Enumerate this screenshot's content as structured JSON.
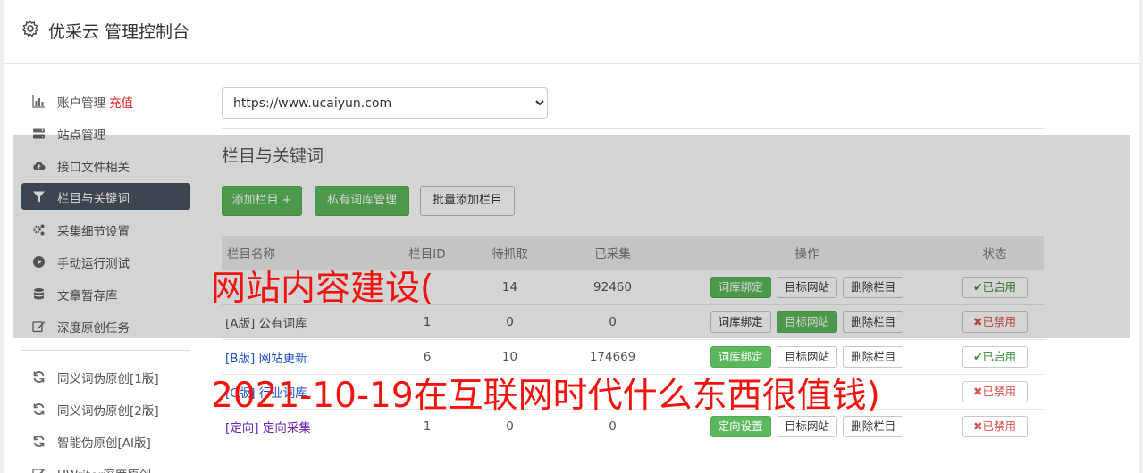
{
  "header": {
    "title": "优采云 管理控制台",
    "icon": "gear-icon"
  },
  "sidebar": {
    "items": [
      {
        "label": "账户管理",
        "extra": "充值",
        "icon": "bar-chart-icon"
      },
      {
        "label": "站点管理",
        "icon": "server-icon"
      },
      {
        "label": "接口文件相关",
        "icon": "cloud-upload-icon"
      },
      {
        "label": "栏目与关键词",
        "icon": "filter-icon",
        "active": true
      },
      {
        "label": "采集细节设置",
        "icon": "cogs-icon"
      },
      {
        "label": "手动运行测试",
        "icon": "play-circle-icon"
      },
      {
        "label": "文章暂存库",
        "icon": "database-icon"
      },
      {
        "label": "深度原创任务",
        "icon": "edit-icon"
      },
      {
        "label": "同义词伪原创[1版]",
        "icon": "refresh-icon"
      },
      {
        "label": "同义词伪原创[2版]",
        "icon": "refresh-icon"
      },
      {
        "label": "智能伪原创[AI版]",
        "icon": "refresh-icon"
      },
      {
        "label": "UWriter深度原创",
        "icon": "edit-icon"
      }
    ]
  },
  "main": {
    "site_select": "https://www.ucaiyun.com",
    "section_title": "栏目与关键词",
    "buttons": {
      "add_column": "添加栏目 +",
      "private_lib": "私有词库管理",
      "batch_add": "批量添加栏目"
    },
    "table": {
      "headers": {
        "name": "栏目名称",
        "id": "栏目ID",
        "pending": "待抓取",
        "collected": "已采集",
        "ops": "操作",
        "status": "状态"
      },
      "rows": [
        {
          "tag": "",
          "name": "",
          "id": "",
          "pending": "14",
          "collected": "92460",
          "op1": "词库绑定",
          "op2": "目标网站",
          "op3": "删除栏目",
          "status": "已启用"
        },
        {
          "tag": "[A版]",
          "name": "公有词库",
          "id": "1",
          "pending": "0",
          "collected": "0",
          "op1": "词库绑定",
          "op2": "目标网站",
          "op3": "删除栏目",
          "status": "已禁用"
        },
        {
          "tag": "[B版]",
          "name": "网站更新",
          "id": "6",
          "pending": "10",
          "collected": "174669",
          "op1": "词库绑定",
          "op2": "目标网站",
          "op3": "删除栏目",
          "status": "已启用"
        },
        {
          "tag": "[C版]",
          "name": "行业词库",
          "id": "",
          "pending": "",
          "collected": "",
          "op1": "",
          "op2": "",
          "op3": "",
          "status": "已禁用"
        },
        {
          "tag": "[定向]",
          "name": "定向采集",
          "id": "1",
          "pending": "0",
          "collected": "0",
          "op1": "定向设置",
          "op2": "目标网站",
          "op3": "删除栏目",
          "status": "已禁用"
        }
      ]
    }
  },
  "watermark": {
    "line1": "网站内容建设(",
    "line2": "2021-10-19在互联网时代什么东西很值钱)"
  },
  "colors": {
    "accent_green": "#5cb85c",
    "active_bg": "#4a5360",
    "watermark_red": "#f2120e",
    "link_blue": "#1e50c8"
  }
}
